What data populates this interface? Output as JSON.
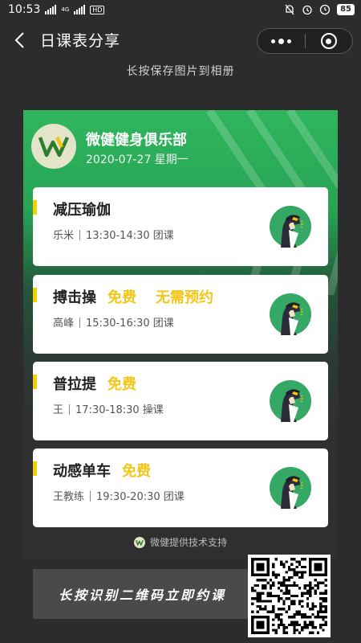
{
  "status": {
    "time": "10:53",
    "network": "4G",
    "hd": "HD",
    "battery": "85"
  },
  "nav": {
    "title": "日课表分享"
  },
  "hint": "长按保存图片到相册",
  "club": {
    "name": "微健健身俱乐部",
    "date": "2020-07-27 星期一"
  },
  "classes": [
    {
      "name": "减压瑜伽",
      "tag": "",
      "tag2": "",
      "coach": "乐米",
      "time": "13:30-14:30",
      "type": "团课"
    },
    {
      "name": "搏击操",
      "tag": "免费",
      "tag2": "无需预约",
      "coach": "高峰",
      "time": "15:30-16:30",
      "type": "团课"
    },
    {
      "name": "普拉提",
      "tag": "免费",
      "tag2": "",
      "coach": "王",
      "time": "17:30-18:30",
      "type": "操课"
    },
    {
      "name": "动感单车",
      "tag": "免费",
      "tag2": "",
      "coach": "王教练",
      "time": "19:30-20:30",
      "type": "团课"
    }
  ],
  "support": "微健提供技术支持",
  "cta": "长按识别二维码立即约课",
  "colors": {
    "accent": "#f4d000",
    "tag": "#f5c518",
    "green": "#2fb65d",
    "avatar_bg": "#35a865"
  }
}
